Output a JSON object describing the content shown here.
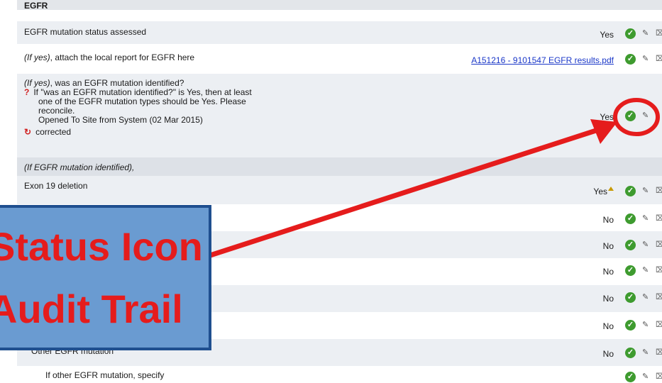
{
  "section_title": "EGFR",
  "rows": [
    {
      "label": "EGFR mutation status assessed",
      "value": "Yes"
    },
    {
      "label_prefix": "(If yes)",
      "label": ", attach the local report for EGFR here",
      "link": "A151216 - 9101547 EGFR results.pdf"
    },
    {
      "label_prefix": "(If yes)",
      "label": ", was an EGFR mutation identified?",
      "query_text_1": "If \"was an EGFR mutation identified?\" is Yes, then at least",
      "query_text_2": "one of the EGFR mutation types should be Yes. Please",
      "query_text_3": "reconcile.",
      "query_opened": "Opened To Site from System (02 Mar 2015)",
      "corrected_label": "corrected",
      "value": "Yes"
    },
    {
      "label": "(If EGFR mutation identified),"
    },
    {
      "label": "Exon 19 deletion",
      "value": "Yes"
    },
    {
      "value": "No"
    },
    {
      "value": "No"
    },
    {
      "value": "No"
    },
    {
      "value": "No"
    },
    {
      "value": "No"
    },
    {
      "label": "Other EGFR mutation",
      "value": "No"
    },
    {
      "label": "If other EGFR mutation, specify"
    }
  ],
  "callout": {
    "line1": "Status Icon",
    "line2": "Audit Trail"
  },
  "icons": {
    "check": "check-circle-icon",
    "pencil": "pencil-icon",
    "trash": "trash-icon"
  },
  "colors": {
    "callout_fill": "#6a9bd1",
    "callout_border": "#1f4f8f",
    "callout_text": "#e51c1c",
    "arrow": "#e51c1c",
    "check": "#3e9b2f"
  }
}
